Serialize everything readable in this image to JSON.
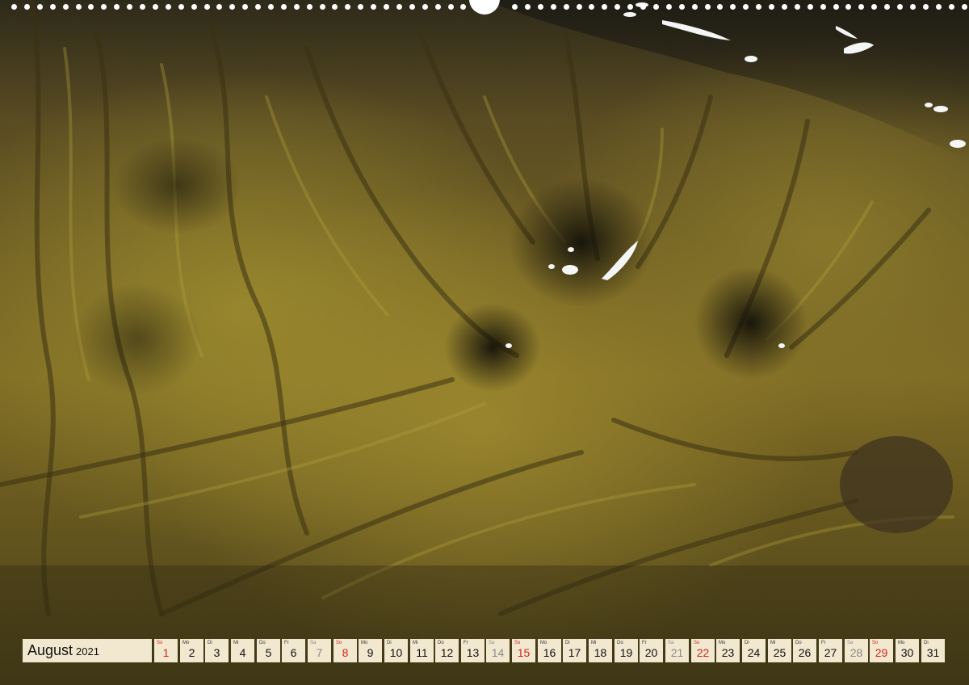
{
  "calendar": {
    "month": "August",
    "year": "2021",
    "days": [
      {
        "dow": "So",
        "num": "1",
        "type": "sun"
      },
      {
        "dow": "Mo",
        "num": "2",
        "type": "week"
      },
      {
        "dow": "Di",
        "num": "3",
        "type": "week"
      },
      {
        "dow": "Mi",
        "num": "4",
        "type": "week"
      },
      {
        "dow": "Do",
        "num": "5",
        "type": "week"
      },
      {
        "dow": "Fr",
        "num": "6",
        "type": "week"
      },
      {
        "dow": "Sa",
        "num": "7",
        "type": "sat"
      },
      {
        "dow": "So",
        "num": "8",
        "type": "sun"
      },
      {
        "dow": "Mo",
        "num": "9",
        "type": "week"
      },
      {
        "dow": "Di",
        "num": "10",
        "type": "week"
      },
      {
        "dow": "Mi",
        "num": "11",
        "type": "week"
      },
      {
        "dow": "Do",
        "num": "12",
        "type": "week"
      },
      {
        "dow": "Fr",
        "num": "13",
        "type": "week"
      },
      {
        "dow": "Sa",
        "num": "14",
        "type": "sat"
      },
      {
        "dow": "So",
        "num": "15",
        "type": "sun"
      },
      {
        "dow": "Mo",
        "num": "16",
        "type": "week"
      },
      {
        "dow": "Di",
        "num": "17",
        "type": "week"
      },
      {
        "dow": "Mi",
        "num": "18",
        "type": "week"
      },
      {
        "dow": "Do",
        "num": "19",
        "type": "week"
      },
      {
        "dow": "Fr",
        "num": "20",
        "type": "week"
      },
      {
        "dow": "Sa",
        "num": "21",
        "type": "sat"
      },
      {
        "dow": "So",
        "num": "22",
        "type": "sun"
      },
      {
        "dow": "Mo",
        "num": "23",
        "type": "week"
      },
      {
        "dow": "Di",
        "num": "24",
        "type": "week"
      },
      {
        "dow": "Mi",
        "num": "25",
        "type": "week"
      },
      {
        "dow": "Do",
        "num": "26",
        "type": "week"
      },
      {
        "dow": "Fr",
        "num": "27",
        "type": "week"
      },
      {
        "dow": "Sa",
        "num": "28",
        "type": "sat"
      },
      {
        "dow": "So",
        "num": "29",
        "type": "sun"
      },
      {
        "dow": "Mo",
        "num": "30",
        "type": "week"
      },
      {
        "dow": "Di",
        "num": "31",
        "type": "week"
      }
    ]
  },
  "colors": {
    "strip_background": "#f1e8cf",
    "sunday": "#d42420",
    "saturday": "#8a8a8a",
    "weekday": "#111111"
  },
  "photo": {
    "subject_icon": "mossy-lava-mountain-landscape"
  }
}
